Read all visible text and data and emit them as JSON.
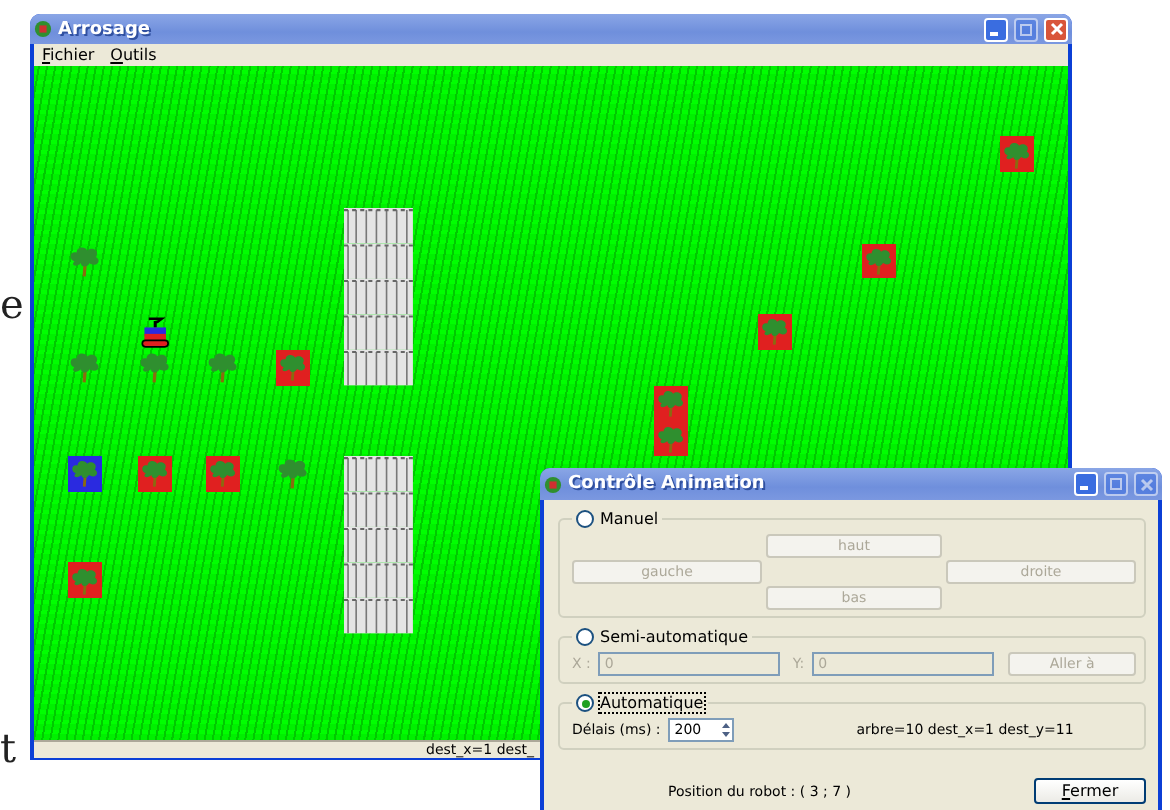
{
  "backdrop_fragments": [
    "e",
    "t"
  ],
  "window": {
    "title": "Arrosage",
    "menu": [
      "Fichier",
      "Outils"
    ]
  },
  "field": {
    "cells": [
      {
        "kind": "tile",
        "color": "#e02020"
      },
      {
        "kind": "tile",
        "color": "#e02020"
      },
      {
        "kind": "tree"
      },
      {
        "kind": "wall"
      },
      {
        "kind": "tile",
        "color": "#e02020"
      },
      {
        "kind": "robot"
      },
      {
        "kind": "tree"
      },
      {
        "kind": "tree"
      },
      {
        "kind": "tree"
      },
      {
        "kind": "tile",
        "color": "#e02020"
      },
      {
        "kind": "tile",
        "color": "#e02020"
      },
      {
        "kind": "tile",
        "color": "#e02020"
      },
      {
        "kind": "tile",
        "color": "#2a2ae0"
      },
      {
        "kind": "tile",
        "color": "#e02020"
      },
      {
        "kind": "tile",
        "color": "#e02020"
      },
      {
        "kind": "tree"
      },
      {
        "kind": "wall"
      },
      {
        "kind": "tile",
        "color": "#e02020"
      }
    ]
  },
  "status": "dest_x=1 dest_",
  "dialog": {
    "title": "Contrôle Animation",
    "modes": [
      {
        "kind": "manual",
        "label": "Manuel",
        "selected": false,
        "buttons": [
          "haut",
          "gauche",
          "droite",
          "bas"
        ]
      },
      {
        "kind": "semi",
        "label": "Semi-automatique",
        "selected": false,
        "x_label": "X :",
        "x_value": "0",
        "y_label": "Y:",
        "y_value": "0",
        "button": "Aller à"
      },
      {
        "kind": "auto",
        "label": "Automatique",
        "selected": true,
        "delay_label": "Délais (ms) :",
        "delay_value": "200",
        "info": "arbre=10 dest_x=1 dest_y=11"
      }
    ],
    "position": "Position du robot : ( 3 ; 7 )",
    "close": "Fermer"
  }
}
